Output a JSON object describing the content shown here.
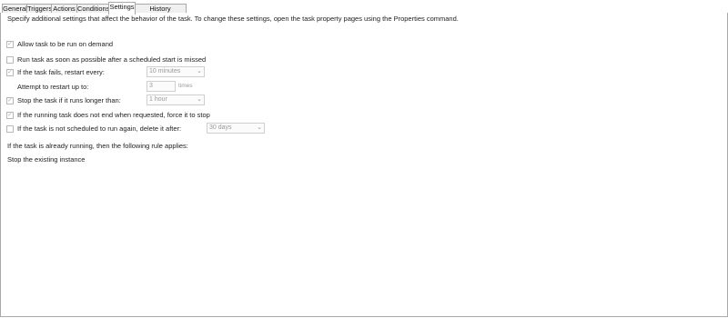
{
  "tabs": [
    {
      "label": "General",
      "active": false
    },
    {
      "label": "Triggers",
      "active": false
    },
    {
      "label": "Actions",
      "active": false
    },
    {
      "label": "Conditions",
      "active": false
    },
    {
      "label": "Settings",
      "active": true
    },
    {
      "label": "History (disabled)",
      "active": false
    }
  ],
  "description": "Specify additional settings that affect the behavior of the task. To change these settings, open the task property pages using the Properties command.",
  "settings": {
    "allow_on_demand": {
      "label": "Allow task to be run on demand",
      "checked": true
    },
    "run_asap": {
      "label": "Run task as soon as possible after a scheduled start is missed",
      "checked": false
    },
    "restart_on_fail": {
      "label": "If the task fails, restart every:",
      "checked": true,
      "value": "10 minutes"
    },
    "restart_attempts": {
      "label": "Attempt to restart up to:",
      "value": "3",
      "unit": "times"
    },
    "stop_if_longer": {
      "label": "Stop the task if it runs longer than:",
      "checked": true,
      "value": "1 hour"
    },
    "force_stop": {
      "label": "If the running task does not end when requested, force it to stop",
      "checked": true
    },
    "delete_if_not_scheduled": {
      "label": "If the task is not scheduled to run again, delete it after:",
      "checked": false,
      "value": "30 days"
    },
    "running_rule_label": "If the task is already running, then the following rule applies:",
    "running_rule_value": "Stop the existing instance"
  },
  "icons": {
    "checkmark": "checkmark-icon",
    "dropdown": "chevron-down-icon"
  }
}
